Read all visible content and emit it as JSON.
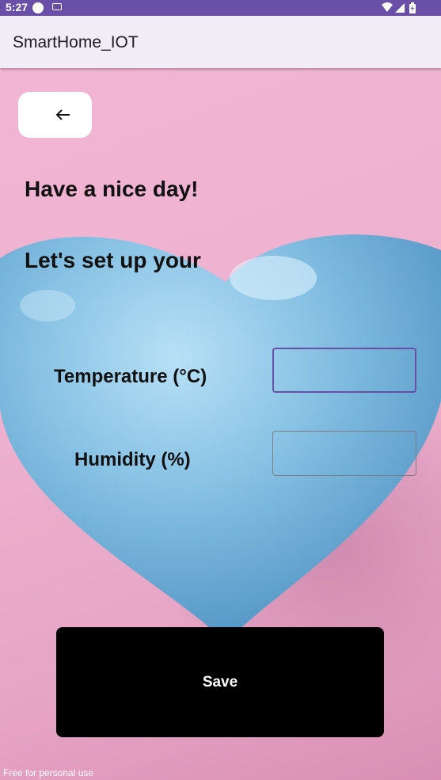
{
  "status_bar": {
    "time": "5:27",
    "icons": [
      "circle-icon",
      "keyboard-icon",
      "wifi-icon",
      "signal-icon",
      "battery-icon"
    ]
  },
  "app_bar": {
    "title": "SmartHome_IOT"
  },
  "back_button": {
    "icon": "back-arrow-icon"
  },
  "greeting": "Have a nice day!",
  "setup_text": "Let's set up your",
  "fields": {
    "temperature": {
      "label": "Temperature (°C)",
      "value": ""
    },
    "humidity": {
      "label": "Humidity (%)",
      "value": ""
    }
  },
  "save_button": {
    "label": "Save"
  },
  "watermark": "Free for personal use",
  "colors": {
    "status_bar": "#6a4fa8",
    "app_bar": "#f2ecf6",
    "background_pink": "#efb0cf",
    "heart_blue": "#7fbbe0",
    "focused_border": "#6750a4",
    "save_button": "#000000"
  }
}
